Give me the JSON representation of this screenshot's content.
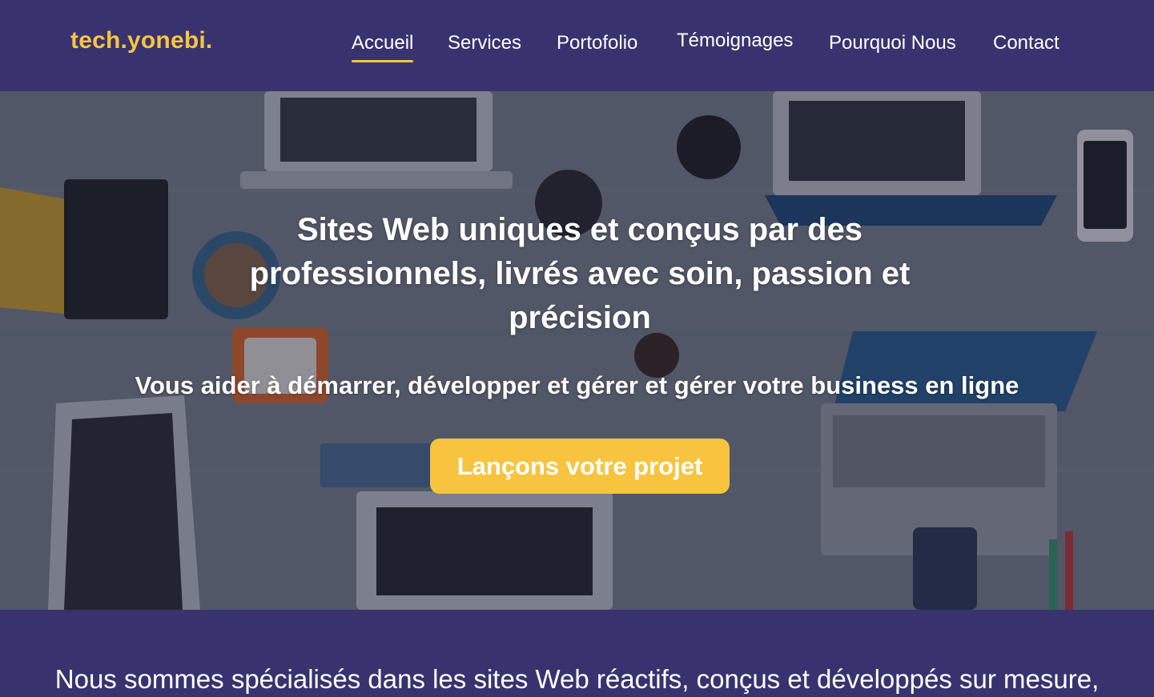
{
  "brand": {
    "logo": "tech.yonebi."
  },
  "nav": {
    "items": [
      {
        "label": "Accueil",
        "active": true
      },
      {
        "label": "Services"
      },
      {
        "label": "Portofolio"
      },
      {
        "label": "Témoignages"
      },
      {
        "label": "Pourquoi Nous"
      },
      {
        "label": "Contact"
      }
    ]
  },
  "hero": {
    "title": "Sites Web uniques et conçus par des professionnels, livrés avec soin, passion et précision",
    "subtitle": "Vous aider à démarrer, développer et gérer et gérer votre business en ligne",
    "cta_label": "Lançons votre projet",
    "background_image": "overhead-desk-with-laptops-photo"
  },
  "intro": {
    "text": "Nous sommes spécialisés dans les sites Web réactifs, conçus et développés sur mesure,"
  },
  "colors": {
    "navy": "#38336f",
    "accent": "#f8c440",
    "text": "#ffffff"
  }
}
